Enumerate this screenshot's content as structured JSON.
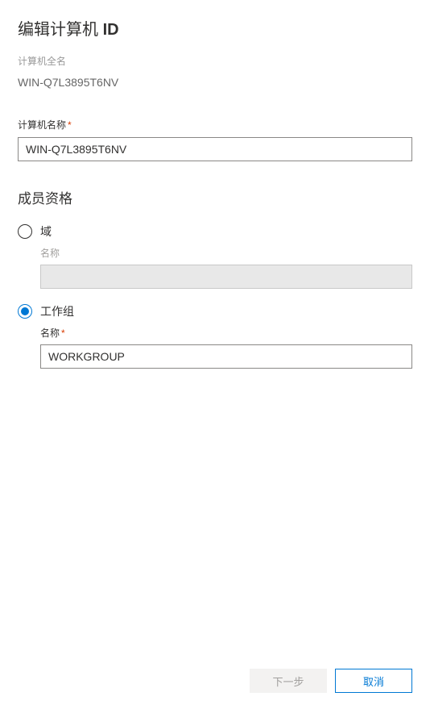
{
  "title_prefix": "编辑计算机 ",
  "title_bold": "ID",
  "full_name_label": "计算机全名",
  "full_name_value": "WIN-Q7L3895T6NV",
  "computer_name_label": "计算机名称",
  "computer_name_value": "WIN-Q7L3895T6NV",
  "membership_title": "成员资格",
  "domain": {
    "label": "域",
    "name_label": "名称",
    "name_value": ""
  },
  "workgroup": {
    "label": "工作组",
    "name_label": "名称",
    "name_value": "WORKGROUP"
  },
  "buttons": {
    "next": "下一步",
    "cancel": "取消"
  },
  "required_mark": "*"
}
